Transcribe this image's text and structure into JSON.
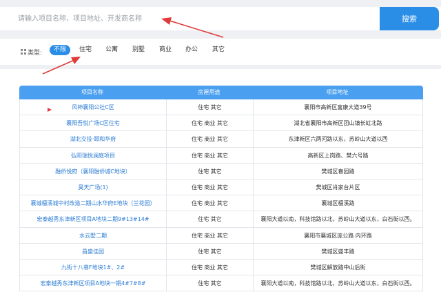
{
  "search": {
    "placeholder": "请输入项目名称、项目地址、开发商名称",
    "button_label": "搜索"
  },
  "filter": {
    "label": "类型:",
    "options": [
      "不限",
      "住宅",
      "公寓",
      "别墅",
      "商业",
      "办公",
      "其它"
    ],
    "active_index": 0
  },
  "table": {
    "headers": [
      "项目名称",
      "房屋用途",
      "项目地址"
    ],
    "rows": [
      {
        "name": "风神襄阳公社C区",
        "use": "住宅 其它",
        "address": "襄阳市高新区富康大道39号"
      },
      {
        "name": "襄阳吾悦广场C区住宅",
        "use": "住宅 商业 其它",
        "address": "湖北省襄阳市高新区团山镇长虹北路"
      },
      {
        "name": "湖北交投·颐和华府",
        "use": "住宅 商业 其它",
        "address": "东津新区六两河路以东，苏岭山大道以西"
      },
      {
        "name": "弘阳瑞悦澜庭项目",
        "use": "住宅 商业 其它",
        "address": "高新区上岗路、樊六号路"
      },
      {
        "name": "融侨悦府（襄阳融侨城C地块）",
        "use": "住宅 其它",
        "address": "樊城区春园路"
      },
      {
        "name": "昊天广场(1)",
        "use": "住宅 商业 其它",
        "address": "樊城区肖家台片区"
      },
      {
        "name": "襄城檀溪城中村改造二期山水华府E地块（兰花园）",
        "use": "住宅 商业 其它",
        "address": "襄城区檀溪路"
      },
      {
        "name": "宏泰越秀东津新区项目A地块二期9#13#14#",
        "use": "住宅 其它",
        "address": "襄阳大道以南，科技馆路以北，苏岭山大道以东，白石街以西。"
      },
      {
        "name": "水云墅二期",
        "use": "住宅 商业 其它",
        "address": "襄阳市襄城区庞公路 内环路"
      },
      {
        "name": "昌盛佳园",
        "use": "住宅 其它",
        "address": "樊城区盛丰路"
      },
      {
        "name": "九街十八巷F地块1#、2#",
        "use": "住宅 商业 其它",
        "address": "樊城区解放路中山后街"
      },
      {
        "name": "宏泰越秀东津新区项目A地块一期4#7#8#",
        "use": "住宅 其它",
        "address": "襄阳大道以南，科技馆路以北，苏岭山大道以东，白石街以西。"
      }
    ]
  },
  "colors": {
    "accent": "#2a8ee6",
    "header": "#4a9ff0",
    "link": "#2a7bd4",
    "annotation": "#e03a3a"
  }
}
